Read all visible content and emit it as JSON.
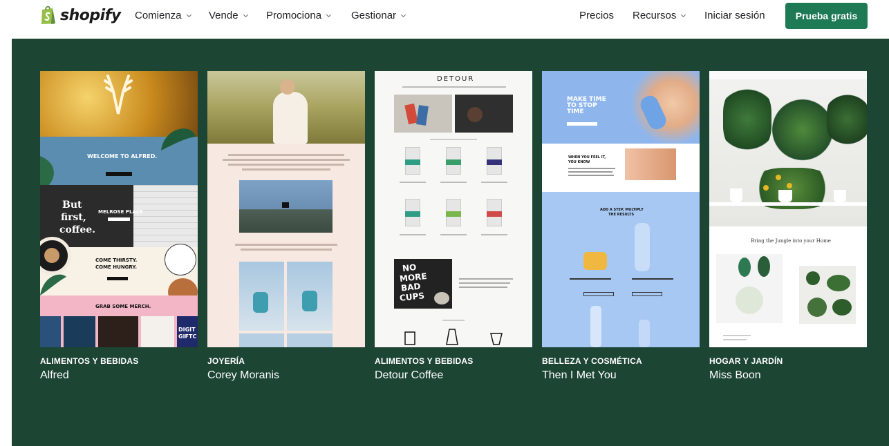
{
  "brand": {
    "name": "shopify"
  },
  "nav": {
    "left": [
      {
        "label": "Comienza"
      },
      {
        "label": "Vende"
      },
      {
        "label": "Promociona"
      },
      {
        "label": "Gestionar"
      }
    ],
    "right": {
      "pricing": "Precios",
      "resources": "Recursos",
      "login": "Iniciar sesión",
      "cta": "Prueba gratis"
    }
  },
  "colors": {
    "panel": "#1c4534",
    "cta": "#1e7a55",
    "logo_green": "#95bf47"
  },
  "icons": {
    "chevron": "chevron-down-icon",
    "logo": "shopify-bag-icon"
  },
  "stores": [
    {
      "category": "ALIMENTOS Y BEBIDAS",
      "name": "Alfred",
      "preview": {
        "welcome": "WELCOME TO ALFRED.",
        "but": "But",
        "first": "first,",
        "coffee": "coffee.",
        "melrose": "MELROSE PLACE",
        "thirsty": "COME THIRSTY.",
        "hungry": "COME HUNGRY.",
        "merch": "GRAB SOME MERCH.",
        "digital": "DIGIT",
        "giftc": "GIFTC"
      }
    },
    {
      "category": "JOYERÍA",
      "name": "Corey Moranis",
      "preview": {}
    },
    {
      "category": "ALIMENTOS Y BEBIDAS",
      "name": "Detour Coffee",
      "preview": {
        "brand": "DETOUR",
        "slogan_1": "NO",
        "slogan_2": "MORE",
        "slogan_3": "BAD",
        "slogan_4": "CUPS"
      }
    },
    {
      "category": "BELLEZA Y COSMÉTICA",
      "name": "Then I Met You",
      "preview": {
        "headline_1": "MAKE TIME",
        "headline_2": "TO STOP",
        "headline_3": "TIME",
        "feel_1": "WHEN YOU FEEL IT,",
        "feel_2": "YOU KNOW",
        "step_1": "ADD A STEP, MULTIPLY",
        "step_2": "THE RESULTS"
      }
    },
    {
      "category": "HOGAR Y JARDÍN",
      "name": "Miss Boon",
      "preview": {
        "headline": "Bring the Jungle into your Home"
      }
    }
  ]
}
